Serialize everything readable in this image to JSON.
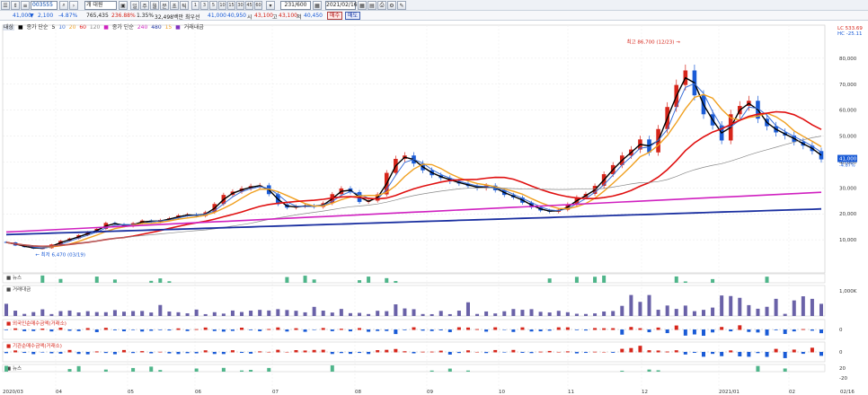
{
  "toolbar": {
    "stock_code": "003555",
    "stock_name": "개 대원",
    "period_buttons": [
      "일",
      "주",
      "월",
      "분",
      "초",
      "틱"
    ],
    "interval_buttons": [
      "1",
      "3",
      "5",
      "10",
      "15",
      "30",
      "45",
      "60"
    ],
    "count": "231/600",
    "date": "2021/02/16"
  },
  "quote": {
    "price": "41,000",
    "change": "2,100",
    "change_pct": "-4.87%",
    "volume": "765,435",
    "volume_change": "236.88%",
    "value1": "1.35%",
    "amount": "32,498백만",
    "label_recent": "최우선",
    "bid": "41,000",
    "ask": "40,950",
    "open_label": "시",
    "open": "43,100",
    "high_label": "고",
    "high": "43,100",
    "low_label": "저",
    "low": "40,450",
    "buy_label": "매수",
    "sell_label": "매도"
  },
  "legend": {
    "tag": "대상",
    "price_label": "종가 단순",
    "ma_short": [
      "5",
      "10",
      "20",
      "60",
      "120"
    ],
    "price_label2": "종가 단순",
    "ma_long": [
      "240",
      "480",
      "15"
    ],
    "volume_label": "거래대금"
  },
  "chart_data": {
    "type": "line",
    "x_ticks": [
      "2020/03",
      "04",
      "05",
      "06",
      "07",
      "08",
      "09",
      "10",
      "11",
      "12",
      "2021/01",
      "02",
      "02/16"
    ],
    "y_ticks": [
      "80,000",
      "70,000",
      "60,000",
      "50,000",
      "40,000",
      "30,000",
      "20,000",
      "10,000"
    ],
    "ylim": [
      0,
      90000
    ],
    "top_right_labels": [
      "LC 533.69",
      "HC -25.11"
    ],
    "current_price_label": "41,000",
    "current_pct_label": "-4.87%",
    "high_annotation": "최고 86,700 (12/23)",
    "low_annotation": "최저 6,470 (03/19)",
    "close": [
      9000,
      7800,
      7200,
      6600,
      6800,
      8200,
      9600,
      10500,
      11800,
      13000,
      14200,
      16500,
      16000,
      15200,
      16400,
      17400,
      16900,
      17600,
      18300,
      19400,
      19800,
      19200,
      20600,
      23800,
      27300,
      28600,
      29800,
      30700,
      31000,
      27600,
      23700,
      22400,
      22900,
      23200,
      22700,
      24100,
      27600,
      29800,
      28400,
      24600,
      25100,
      27500,
      35800,
      41200,
      42500,
      39400,
      36800,
      34900,
      33800,
      32500,
      31700,
      30700,
      29900,
      30900,
      29100,
      27300,
      26300,
      24300,
      22500,
      21300,
      20800,
      21600,
      23700,
      26400,
      27700,
      30800,
      35300,
      38800,
      42500,
      44800,
      48700,
      43700,
      52700,
      61200,
      69700,
      75300,
      65700,
      58400,
      54100,
      48300,
      58400,
      61600,
      63600,
      56700,
      53800,
      51400,
      50200,
      47800,
      46300,
      44200,
      41000
    ],
    "series": [
      {
        "name": "5",
        "color": "#000000"
      },
      {
        "name": "10",
        "color": "#3a6fd8"
      },
      {
        "name": "20",
        "color": "#f0a020"
      },
      {
        "name": "60",
        "color": "#e01010"
      },
      {
        "name": "120",
        "color": "#888888"
      },
      {
        "name": "240",
        "color": "#d020c0"
      },
      {
        "name": "480",
        "color": "#1a2fa0"
      }
    ]
  },
  "subpanels": [
    {
      "title": "뉴스",
      "axis": ""
    },
    {
      "title": "거래대금",
      "axis": "1,000K"
    },
    {
      "title": "외국인순매수금액(거래소)",
      "axis": "0"
    },
    {
      "title": "기관순매수금액(거래소)",
      "axis": "0"
    },
    {
      "title": "뉴스",
      "axis": "20"
    }
  ],
  "subpanel_extra_axis": [
    "-20"
  ],
  "colors": {
    "up": "#d6251a",
    "down": "#1a5bd6",
    "accent": "#1a2fa0"
  }
}
